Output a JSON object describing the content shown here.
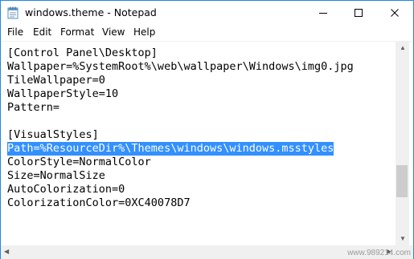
{
  "window": {
    "title": "windows.theme - Notepad"
  },
  "menu": {
    "items": [
      {
        "label": "File"
      },
      {
        "label": "Edit"
      },
      {
        "label": "Format"
      },
      {
        "label": "View"
      },
      {
        "label": "Help"
      }
    ]
  },
  "editor": {
    "lines": [
      {
        "text": "[Control Panel\\Desktop]",
        "selected": false
      },
      {
        "text": "Wallpaper=%SystemRoot%\\web\\wallpaper\\Windows\\img0.jpg",
        "selected": false
      },
      {
        "text": "TileWallpaper=0",
        "selected": false
      },
      {
        "text": "WallpaperStyle=10",
        "selected": false
      },
      {
        "text": "Pattern=",
        "selected": false
      },
      {
        "text": "",
        "selected": false
      },
      {
        "text": "[VisualStyles]",
        "selected": false
      },
      {
        "text": "Path=%ResourceDir%\\Themes\\windows\\windows.msstyles",
        "selected": true
      },
      {
        "text": "ColorStyle=NormalColor",
        "selected": false
      },
      {
        "text": "Size=NormalSize",
        "selected": false
      },
      {
        "text": "AutoColorization=0",
        "selected": false
      },
      {
        "text": "ColorizationColor=0XC40078D7",
        "selected": false
      }
    ],
    "selection_color": "#3390ff"
  },
  "watermark": "www.989214.com",
  "icons": {
    "app": "notepad-icon",
    "minimize": "minimize-icon",
    "maximize": "maximize-icon",
    "close": "close-icon"
  },
  "colors": {
    "border": "#1e88e5"
  }
}
